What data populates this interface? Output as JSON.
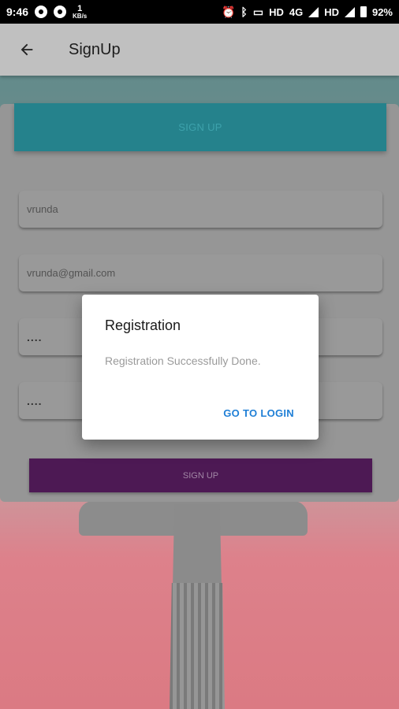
{
  "status_bar": {
    "time": "9:46",
    "data_rate_value": "1",
    "data_rate_unit": "KB/s",
    "network_1": "HD",
    "network_type": "4G",
    "network_2": "HD",
    "battery": "92%"
  },
  "app_bar": {
    "title": "SignUp",
    "back_icon": "arrow-left-icon"
  },
  "form": {
    "top_button_label": "SIGN UP",
    "name_value": "vrunda",
    "email_value": "vrunda@gmail.com",
    "password_value": "....",
    "confirm_password_value": "....",
    "bottom_button_label": "SIGN UP"
  },
  "dialog": {
    "title": "Registration",
    "message": "Registration Successfully Done.",
    "action_label": "GO TO LOGIN"
  },
  "colors": {
    "top_button": "#26858f",
    "bottom_button": "#4f1a56",
    "dialog_action": "#1f7fd6"
  }
}
